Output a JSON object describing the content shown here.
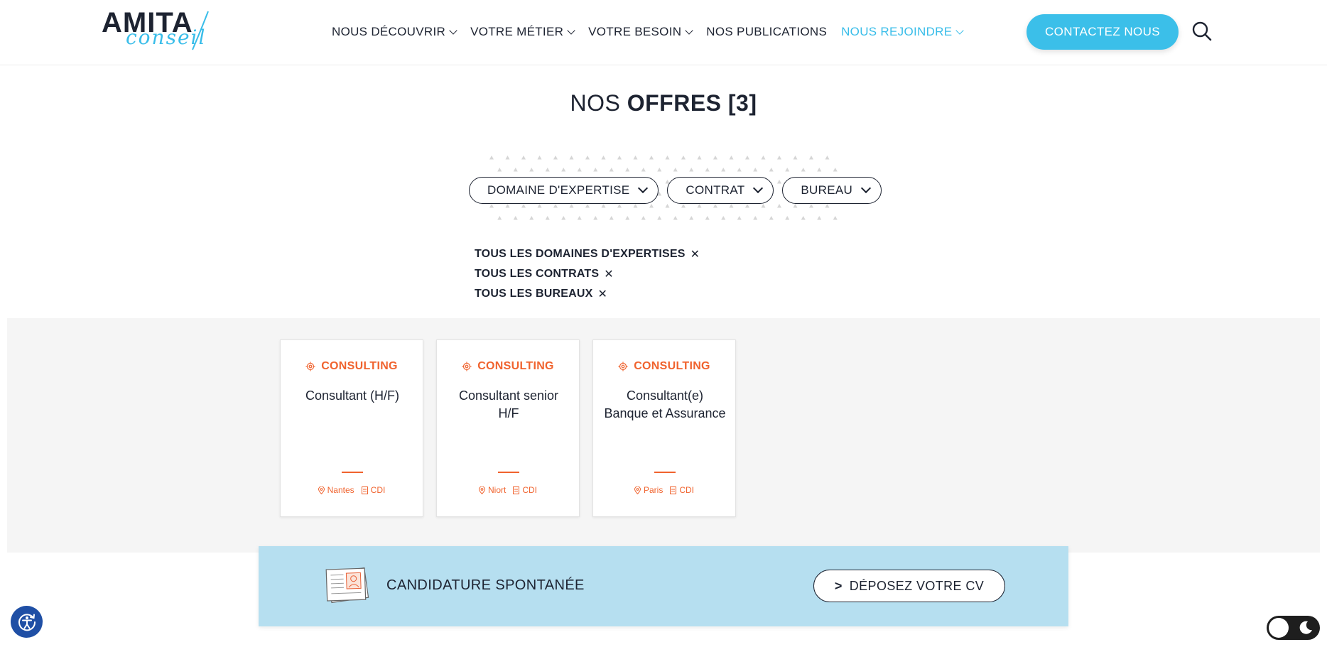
{
  "brand": {
    "logo_word": "AMITA",
    "logo_script": "conseil",
    "accent": "#39bde9",
    "orange": "#f0632e",
    "dark": "#1d2331"
  },
  "nav": {
    "items": [
      {
        "label": "NOUS DÉCOUVRIR",
        "has_menu": true
      },
      {
        "label": "VOTRE MÉTIER",
        "has_menu": true
      },
      {
        "label": "VOTRE BESOIN",
        "has_menu": true
      },
      {
        "label": "NOS PUBLICATIONS",
        "has_menu": false
      },
      {
        "label": "NOUS REJOINDRE",
        "has_menu": true,
        "active": true
      }
    ],
    "contact_label": "CONTACTEZ NOUS"
  },
  "page": {
    "title_light": "NOS ",
    "title_bold": "OFFRES [3]"
  },
  "filters": [
    {
      "label": "DOMAINE D'EXPERTISE"
    },
    {
      "label": "CONTRAT"
    },
    {
      "label": "BUREAU"
    }
  ],
  "active_filters": [
    {
      "label": "TOUS LES DOMAINES D'EXPERTISES"
    },
    {
      "label": "TOUS LES CONTRATS"
    },
    {
      "label": "TOUS LES BUREAUX"
    }
  ],
  "offers": [
    {
      "category": "CONSULTING",
      "title": "Consultant (H/F)",
      "location": "Nantes",
      "contract": "CDI"
    },
    {
      "category": "CONSULTING",
      "title": "Consultant senior H/F",
      "location": "Niort",
      "contract": "CDI"
    },
    {
      "category": "CONSULTING",
      "title": "Consultant(e) Banque et Assurance",
      "location": "Paris",
      "contract": "CDI"
    }
  ],
  "spontaneous": {
    "label": "CANDIDATURE SPONTANÉE",
    "button_prefix": ">",
    "button_label": "DÉPOSEZ VOTRE CV"
  },
  "icons": {
    "search": "search-icon",
    "accessibility": "accessibility-icon",
    "theme": "moon-icon",
    "category": "gear-icon",
    "location": "pin-icon",
    "contract": "document-icon",
    "cv": "cv-documents-icon"
  }
}
